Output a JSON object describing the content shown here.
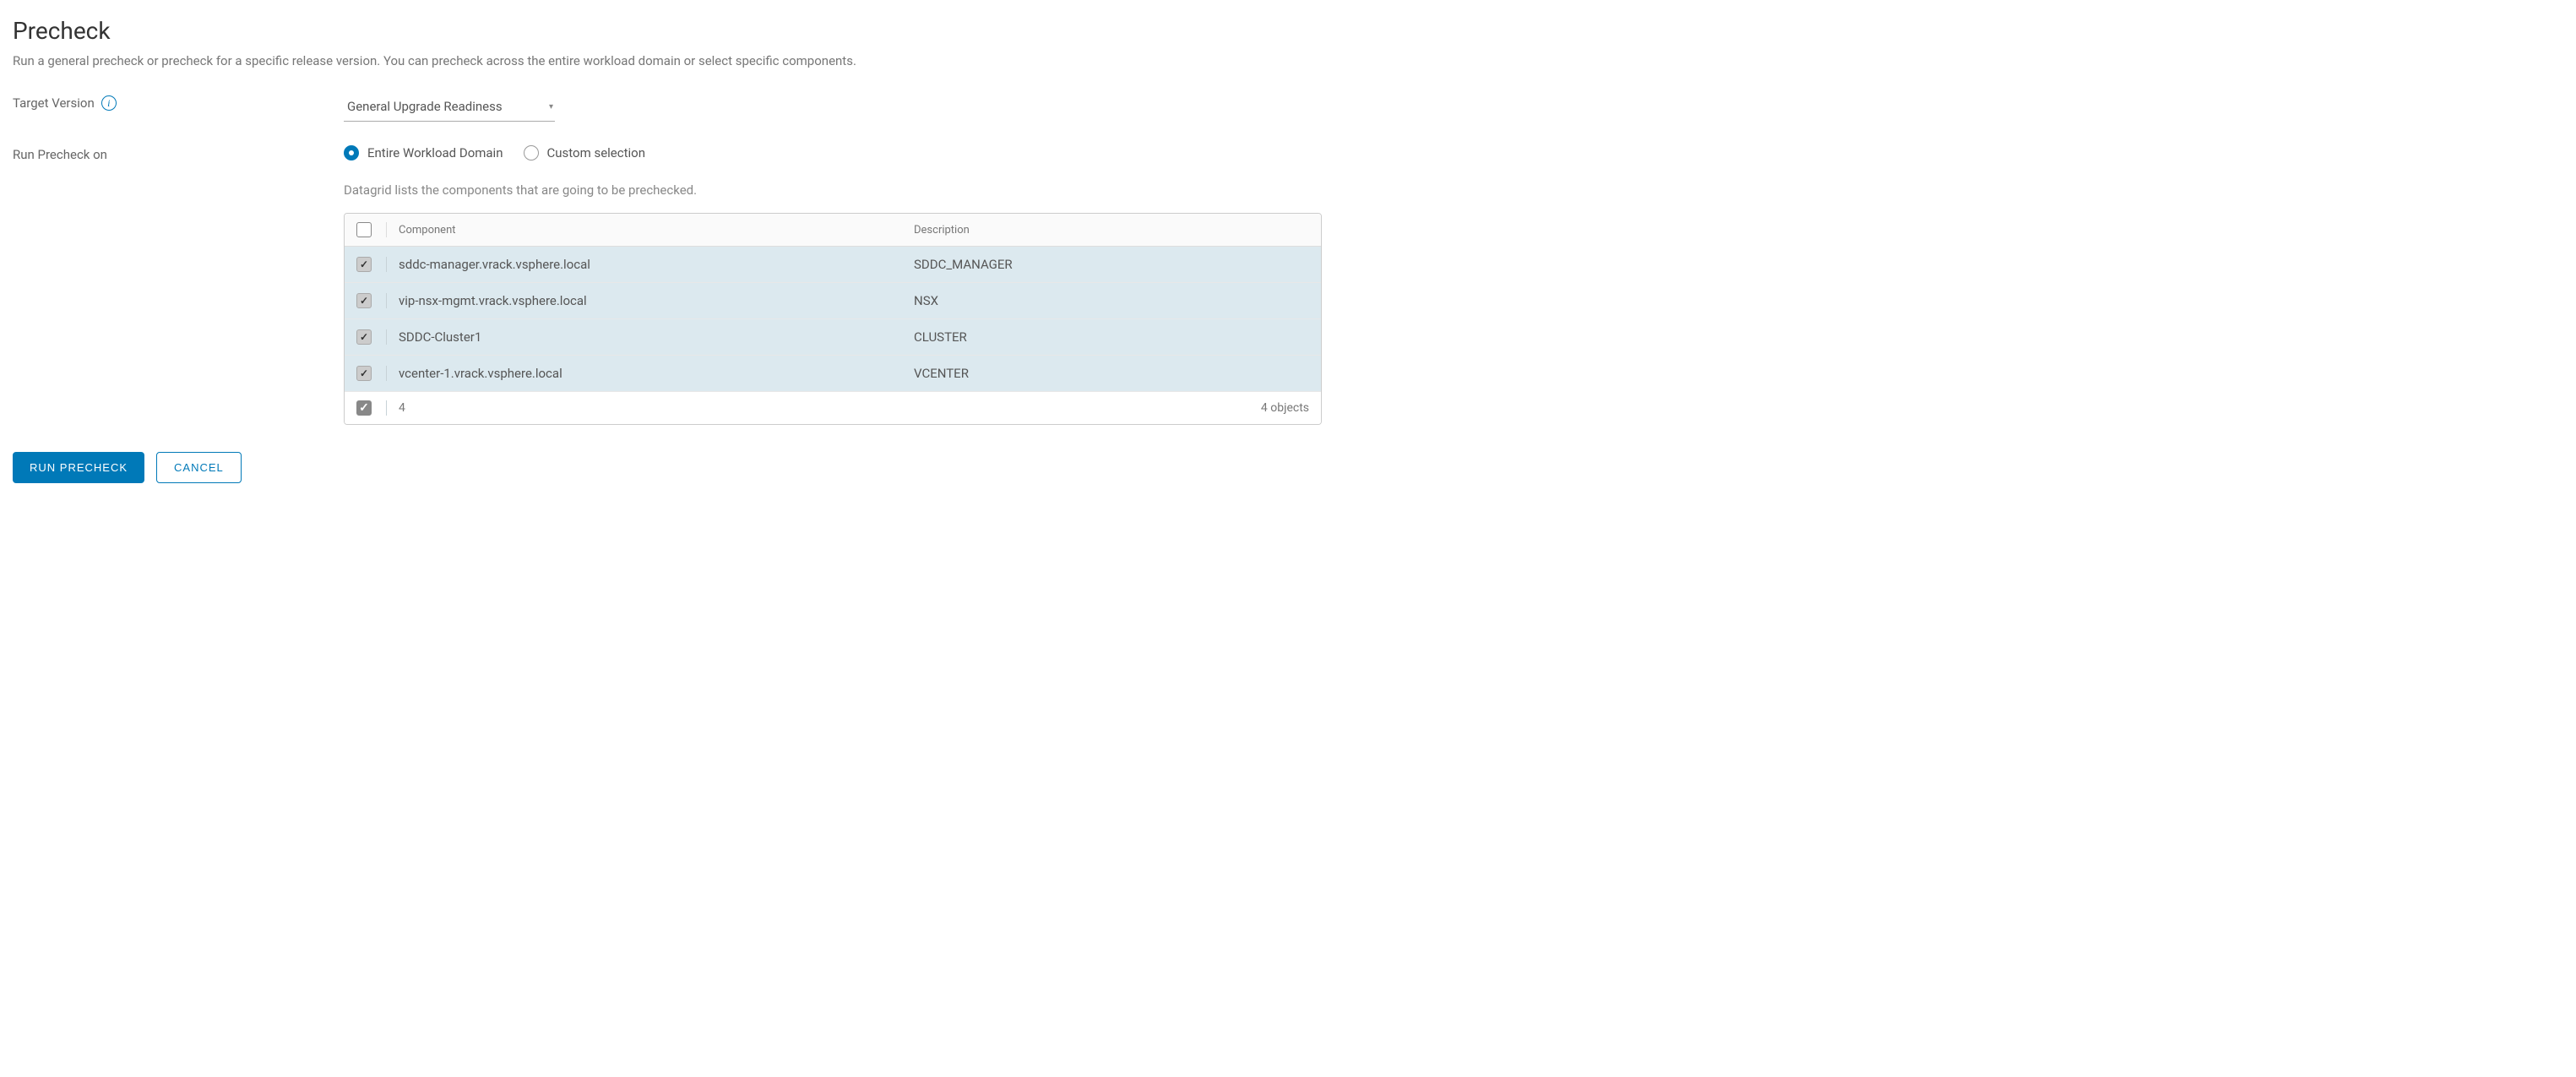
{
  "heading": "Precheck",
  "subtitle": "Run a general precheck or precheck for a specific release version. You can precheck across the entire workload domain or select specific components.",
  "labels": {
    "target_version": "Target Version",
    "run_precheck_on": "Run Precheck on"
  },
  "target_select": {
    "value": "General Upgrade Readiness"
  },
  "scope_radios": {
    "entire": "Entire Workload Domain",
    "custom": "Custom selection",
    "selected": "entire"
  },
  "grid_helper": "Datagrid lists the components that are going to be prechecked.",
  "grid": {
    "headers": {
      "component": "Component",
      "description": "Description"
    },
    "rows": [
      {
        "component": "sddc-manager.vrack.vsphere.local",
        "description": "SDDC_MANAGER",
        "checked": true
      },
      {
        "component": "vip-nsx-mgmt.vrack.vsphere.local",
        "description": "NSX",
        "checked": true
      },
      {
        "component": "SDDC-Cluster1",
        "description": "CLUSTER",
        "checked": true
      },
      {
        "component": "vcenter-1.vrack.vsphere.local",
        "description": "VCENTER",
        "checked": true
      }
    ],
    "selected_count": "4",
    "total_objects": "4 objects"
  },
  "buttons": {
    "run": "RUN PRECHECK",
    "cancel": "CANCEL"
  }
}
